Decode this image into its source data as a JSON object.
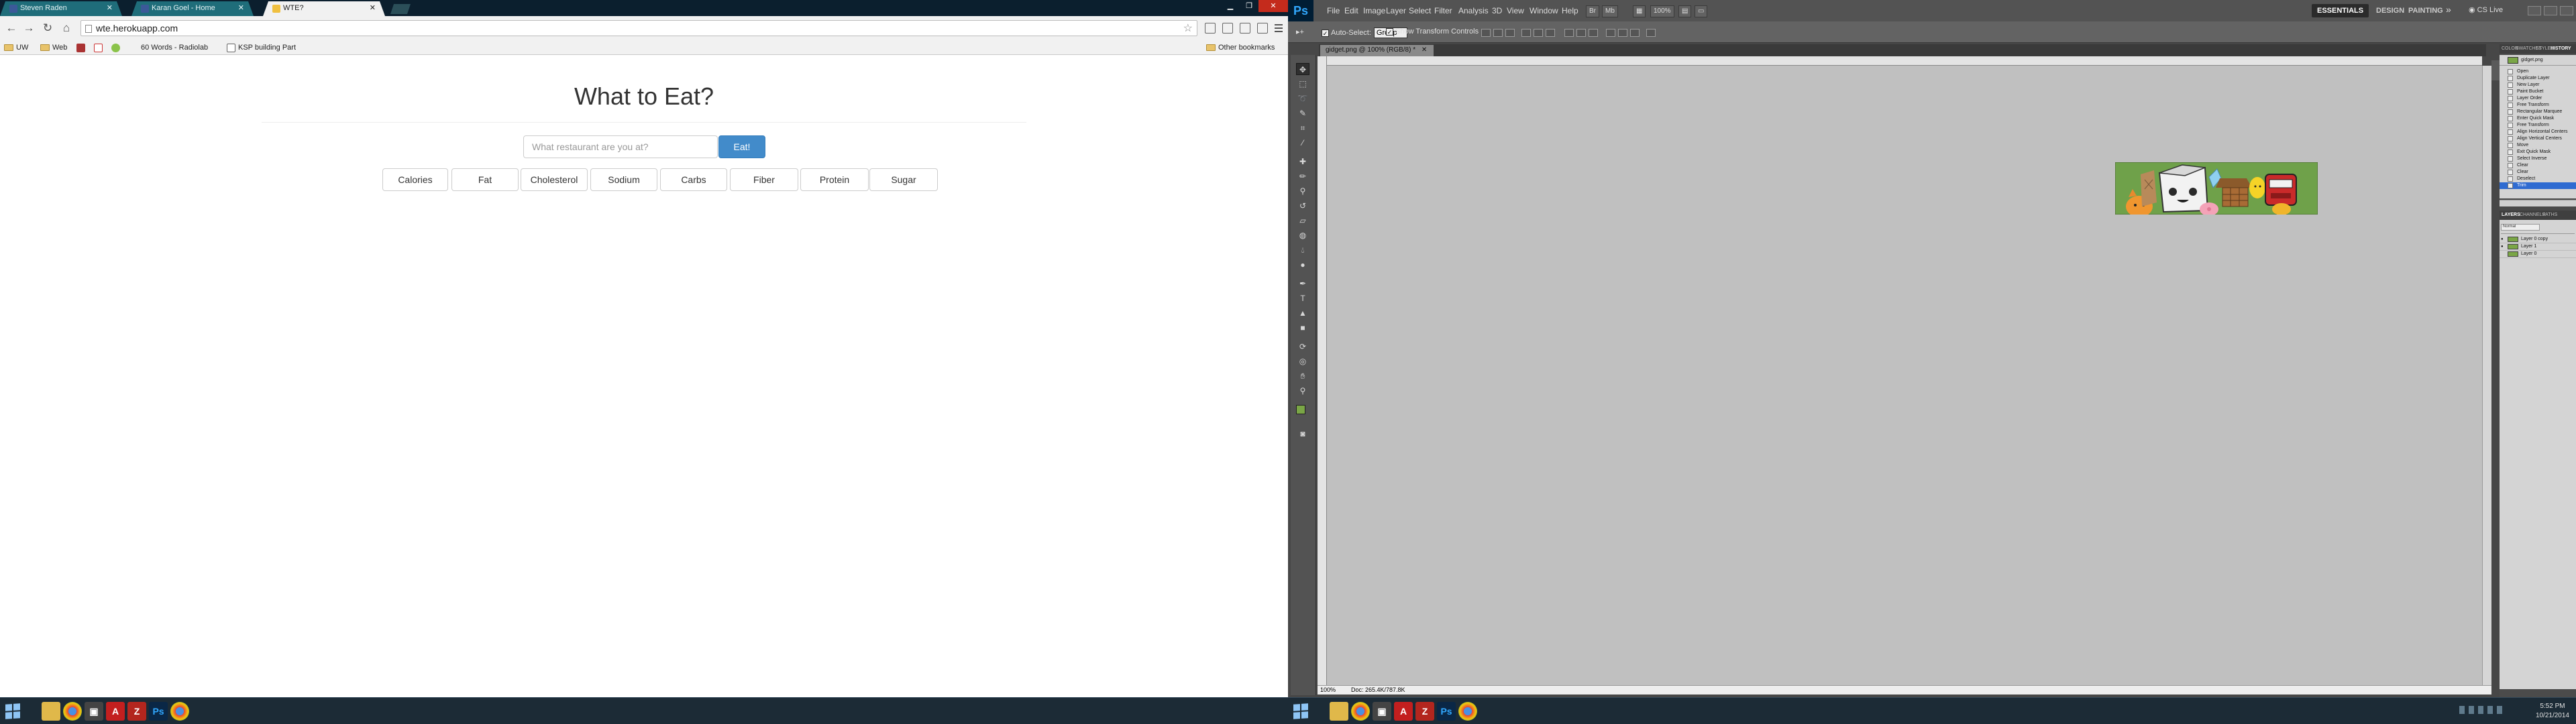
{
  "chrome": {
    "tabs": [
      {
        "title": "Steven Raden",
        "icon": "facebook-icon",
        "color": "#3b5998",
        "active": false
      },
      {
        "title": "Karan Goel - Home",
        "icon": "facebook-icon",
        "color": "#3b5998",
        "active": false
      },
      {
        "title": "WTE?",
        "icon": "page-icon",
        "color": "#f0c040",
        "active": true
      }
    ],
    "url": "wte.herokuapp.com",
    "bookmarks": {
      "items": [
        "UW",
        "Web",
        "",
        "",
        "",
        "60 Words - Radiolab",
        "KSP building Part"
      ],
      "other": "Other bookmarks"
    }
  },
  "app": {
    "title": "What to Eat?",
    "search_placeholder": "What restaurant are you at?",
    "button_label": "Eat!",
    "nutrients": [
      "Calories",
      "Fat",
      "Cholesterol",
      "Sodium",
      "Carbs",
      "Fiber",
      "Protein",
      "Sugar"
    ],
    "accent": "#428bca"
  },
  "photoshop": {
    "logo": "Ps",
    "menu": [
      "File",
      "Edit",
      "Image",
      "Layer",
      "Select",
      "Filter",
      "Analysis",
      "3D",
      "View",
      "Window",
      "Help"
    ],
    "zoom": "100%",
    "workspaces": [
      "ESSENTIALS",
      "DESIGN",
      "PAINTING"
    ],
    "cs_live": "CS Live",
    "options": {
      "auto_select": "Auto-Select:",
      "auto_select_value": "Group",
      "transform_controls": "Show Transform Controls"
    },
    "document_tab": "gidget.png @ 100% (RGB/8) *",
    "status_zoom": "100%",
    "status_doc": "Doc: 265.4K/787.8K",
    "history_tabs": [
      "COLOR",
      "SWATCHES",
      "STYLES",
      "HISTORY"
    ],
    "history_snapshot": "gidget.png",
    "history": [
      "Open",
      "Duplicate Layer",
      "New Layer",
      "Paint Bucket",
      "Layer Order",
      "Free Transform",
      "Rectangular Marquee",
      "Enter Quick Mask",
      "Free Transform",
      "Align Horizontal Centers",
      "Align Vertical Centers",
      "Move",
      "Exit Quick Mask",
      "Select Inverse",
      "Clear",
      "Clear",
      "Deselect",
      "Trim"
    ],
    "history_selected_index": 17,
    "layers_tabs": [
      "LAYERS",
      "CHANNELS",
      "PATHS"
    ],
    "layer_blend": "Normal",
    "layers": [
      "Layer 0 copy",
      "Layer 1",
      "Layer 0"
    ]
  },
  "taskbar": {
    "left_apps": [
      "windows-explorer",
      "chrome",
      "media",
      "acrobat",
      "filezilla",
      "photoshop",
      "chrome"
    ],
    "time": "5:52 PM",
    "date": "10/21/2014"
  }
}
